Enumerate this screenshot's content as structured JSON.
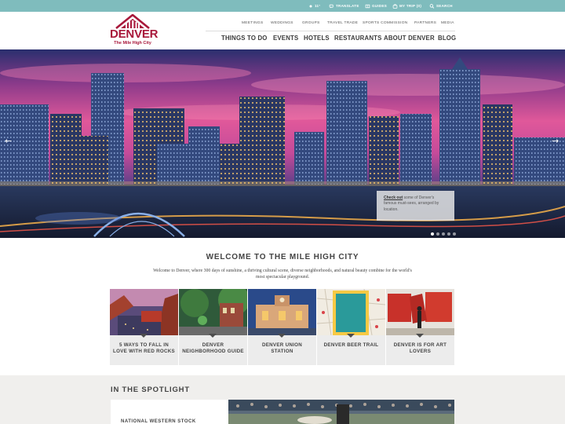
{
  "utility": {
    "weather": "11°",
    "translate": "Translate",
    "guides": "Guides",
    "my_trip": "My Trip (0)",
    "search": "Search"
  },
  "logo": {
    "word": "DENVER",
    "tagline": "The Mile High City"
  },
  "secondary_nav": [
    "Meetings",
    "Weddings",
    "Groups",
    "Travel Trade",
    "Sports Commission",
    "Partners",
    "Media"
  ],
  "primary_nav": [
    "Things To Do",
    "Events",
    "Hotels",
    "Restaurants",
    "About Denver",
    "Blog"
  ],
  "hero": {
    "caption_link": "Check out",
    "caption_text": " some of Denver's famous must-sees, arranged by location.",
    "prev_arrow": "←",
    "next_arrow": "→",
    "slide_count": 5,
    "active_slide": 1
  },
  "welcome": {
    "title": "Welcome to the Mile High City",
    "text": "Welcome to Denver, where 300 days of sunshine, a thriving cultural scene, diverse neighborhoods, and natural beauty combine for the world's most spectacular playground."
  },
  "cards": [
    {
      "label": "5 Ways to Fall in Love with Red Rocks",
      "image": "red-rocks-amphitheatre"
    },
    {
      "label": "Denver Neighborhood Guide",
      "image": "neighborhood-street"
    },
    {
      "label": "Denver Union Station",
      "image": "union-station"
    },
    {
      "label": "Denver Beer Trail",
      "image": "beer-trail-map"
    },
    {
      "label": "Denver is for Art Lovers",
      "image": "art-installation"
    }
  ],
  "spotlight": {
    "title": "In the Spotlight",
    "card_title": "National Western Stock"
  },
  "colors": {
    "utility_bar": "#7fbcbd",
    "brand": "#a8173a",
    "card_bg": "#ececec",
    "spotlight_bg": "#f0efed"
  }
}
